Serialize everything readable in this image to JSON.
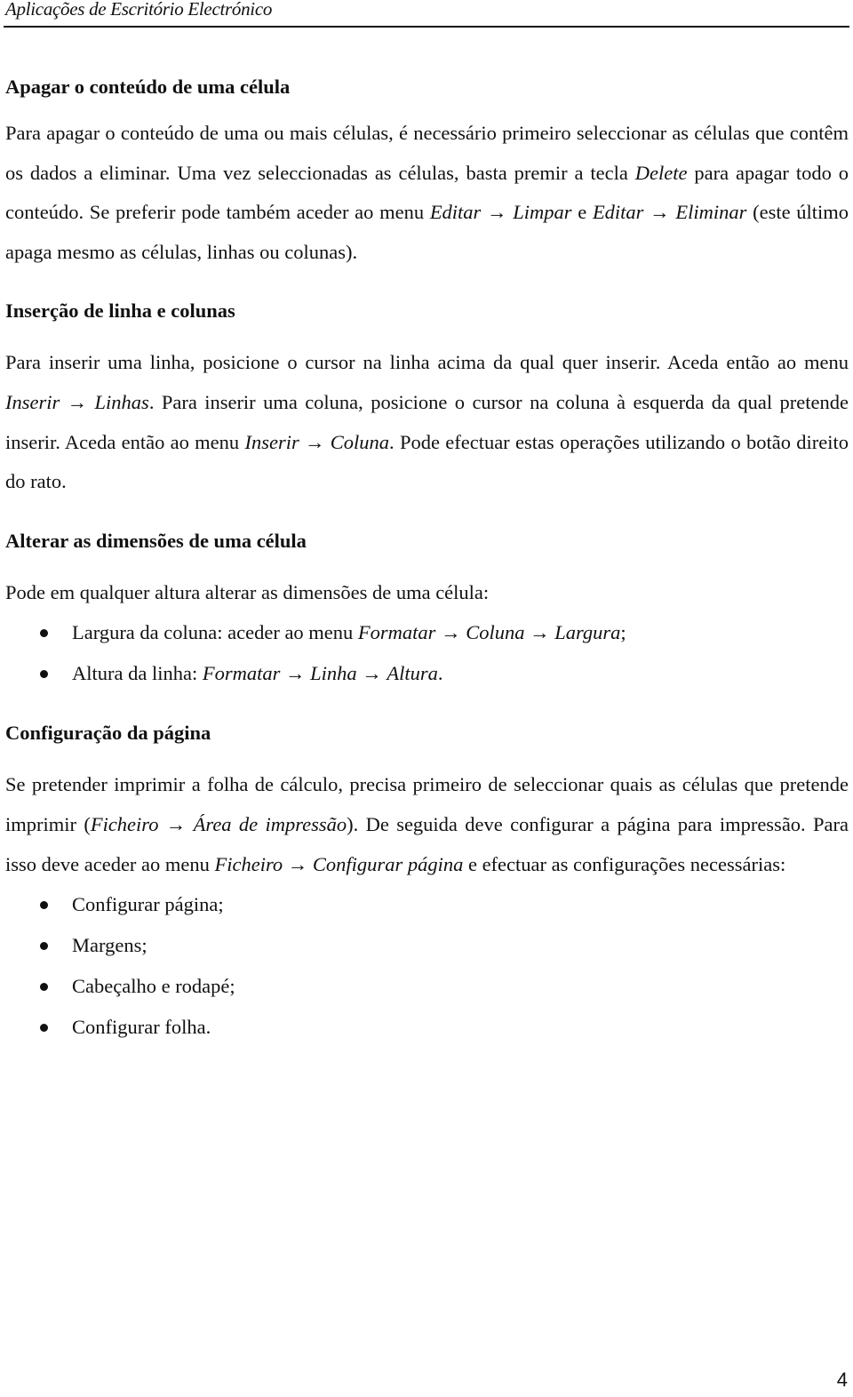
{
  "header": {
    "title": "Aplicações de Escritório Electrónico"
  },
  "sections": [
    {
      "heading": "Apagar o conteúdo de uma célula",
      "paragraph": [
        {
          "t": "Para apagar o conteúdo de uma ou mais células, é necessário primeiro seleccionar as células que contêm os dados a eliminar. Uma vez seleccionadas as células, basta premir a tecla "
        },
        {
          "t": "Delete",
          "i": true
        },
        {
          "t": " para apagar todo o conteúdo. Se preferir pode também aceder ao menu "
        },
        {
          "t": "Editar",
          "i": true
        },
        {
          "t": " → "
        },
        {
          "t": "Limpar",
          "i": true
        },
        {
          "t": " e "
        },
        {
          "t": "Editar",
          "i": true
        },
        {
          "t": " → "
        },
        {
          "t": "Eliminar",
          "i": true
        },
        {
          "t": " (este último apaga mesmo as células, linhas ou colunas)."
        }
      ]
    },
    {
      "heading": "Inserção de linha e colunas",
      "paragraph": [
        {
          "t": "Para inserir uma linha, posicione o cursor na linha acima da qual quer inserir. Aceda então ao menu "
        },
        {
          "t": "Inserir",
          "i": true
        },
        {
          "t": " → "
        },
        {
          "t": "Linhas",
          "i": true
        },
        {
          "t": ". Para inserir uma coluna, posicione o cursor na coluna à esquerda da qual pretende inserir. Aceda então ao menu "
        },
        {
          "t": "Inserir",
          "i": true
        },
        {
          "t": " → "
        },
        {
          "t": "Coluna",
          "i": true
        },
        {
          "t": ". Pode efectuar estas operações utilizando o botão direito do rato."
        }
      ]
    },
    {
      "heading": "Alterar as dimensões de uma célula",
      "paragraph": [
        {
          "t": "Pode em qualquer altura alterar as dimensões de uma célula:"
        }
      ],
      "list": [
        [
          {
            "t": "Largura da coluna: aceder ao menu "
          },
          {
            "t": "Formatar",
            "i": true
          },
          {
            "t": " → "
          },
          {
            "t": "Coluna",
            "i": true
          },
          {
            "t": " → "
          },
          {
            "t": "Largura",
            "i": true
          },
          {
            "t": ";"
          }
        ],
        [
          {
            "t": "Altura da linha: "
          },
          {
            "t": "Formatar",
            "i": true
          },
          {
            "t": " → "
          },
          {
            "t": "Linha",
            "i": true
          },
          {
            "t": " → "
          },
          {
            "t": "Altura",
            "i": true
          },
          {
            "t": "."
          }
        ]
      ]
    },
    {
      "heading": "Configuração da página",
      "paragraph": [
        {
          "t": "Se pretender imprimir a folha de cálculo, precisa primeiro de seleccionar quais as células que pretende imprimir ("
        },
        {
          "t": "Ficheiro",
          "i": true
        },
        {
          "t": " → "
        },
        {
          "t": "Área de impressão",
          "i": true
        },
        {
          "t": "). De seguida deve configurar a página para impressão. Para isso deve aceder ao menu "
        },
        {
          "t": "Ficheiro",
          "i": true
        },
        {
          "t": " → "
        },
        {
          "t": "Configurar página",
          "i": true
        },
        {
          "t": " e efectuar as configurações necessárias:"
        }
      ],
      "list": [
        [
          {
            "t": "Configurar página;"
          }
        ],
        [
          {
            "t": "Margens;"
          }
        ],
        [
          {
            "t": "Cabeçalho e rodapé;"
          }
        ],
        [
          {
            "t": "Configurar folha."
          }
        ]
      ]
    }
  ],
  "footer": {
    "page_number": "4"
  }
}
